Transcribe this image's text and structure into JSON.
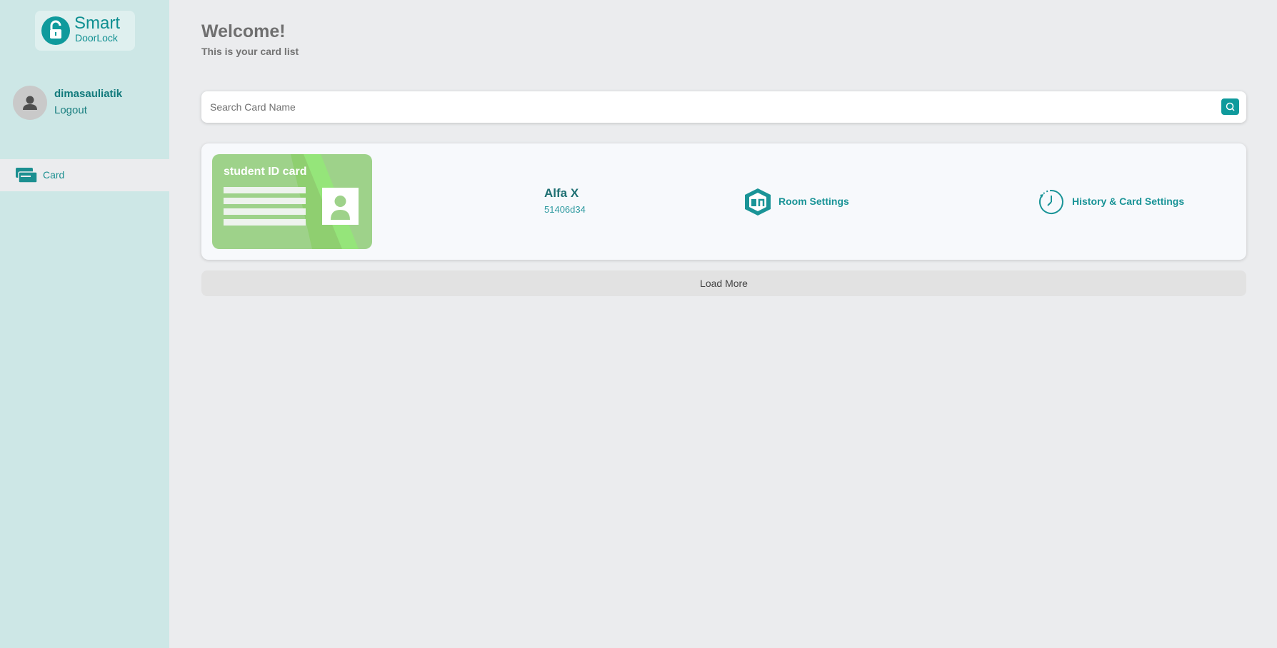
{
  "app": {
    "logo_title": "Smart",
    "logo_subtitle": "DoorLock"
  },
  "user": {
    "name": "dimasauliatik",
    "logout_label": "Logout"
  },
  "sidebar": {
    "items": [
      {
        "label": "Card",
        "icon": "cards-icon",
        "active": true
      }
    ]
  },
  "header": {
    "title": "Welcome!",
    "subtitle": "This is your card list"
  },
  "search": {
    "placeholder": "Search Card Name",
    "value": ""
  },
  "cards": [
    {
      "image_title": "student ID card",
      "name": "Alfa X",
      "code": "51406d34",
      "room_settings_label": "Room Settings",
      "history_label": "History & Card Settings"
    }
  ],
  "load_more_label": "Load More",
  "colors": {
    "accent": "#0f9a9c",
    "sidebar_bg": "#cde7e6",
    "page_bg": "#ebecee",
    "card_green": "#9ed28a"
  }
}
